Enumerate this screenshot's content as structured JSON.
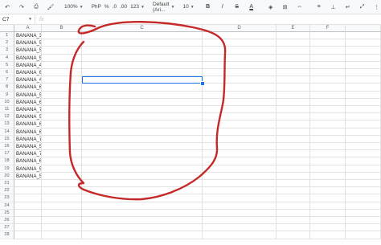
{
  "toolbar": {
    "zoom": "100%",
    "currency": "PhP",
    "percent": "%",
    "decimal_decrease": ".0",
    "decimal_increase": ".00",
    "more_formats": "123",
    "font": "Default (Ari...",
    "font_size": "10",
    "bold": "B",
    "italic": "I",
    "strike": "S",
    "text_color": "A"
  },
  "formula_bar": {
    "cell_ref": "C7",
    "fx": "fx",
    "value": ""
  },
  "columns": [
    "A",
    "B",
    "C",
    "D",
    "E",
    "F"
  ],
  "rows": [
    "1",
    "2",
    "3",
    "4",
    "5",
    "6",
    "7",
    "8",
    "9",
    "10",
    "11",
    "12",
    "13",
    "14",
    "15",
    "16",
    "17",
    "18",
    "19",
    "20",
    "21",
    "22",
    "23",
    "24",
    "25",
    "26",
    "27",
    "28"
  ],
  "cells_a": [
    "BANANA_35426",
    "BANANA_57547",
    "BANANA_56547",
    "BANANA_56456",
    "BANANA_45664",
    "BANANA_65464",
    "BANANA_45446",
    "BANANA_65645",
    "BANANA_56547",
    "BANANA_65475",
    "BANANA_74574",
    "BANANA_56456",
    "BANANA_64564",
    "BANANA_68568",
    "BANANA_75686",
    "BANANA_54757",
    "BANANA_774547",
    "BANANA_674677",
    "BANANA_574577",
    "BANANA_574777"
  ],
  "selected_cell": "C7",
  "annotation": {
    "color": "#c62828"
  }
}
